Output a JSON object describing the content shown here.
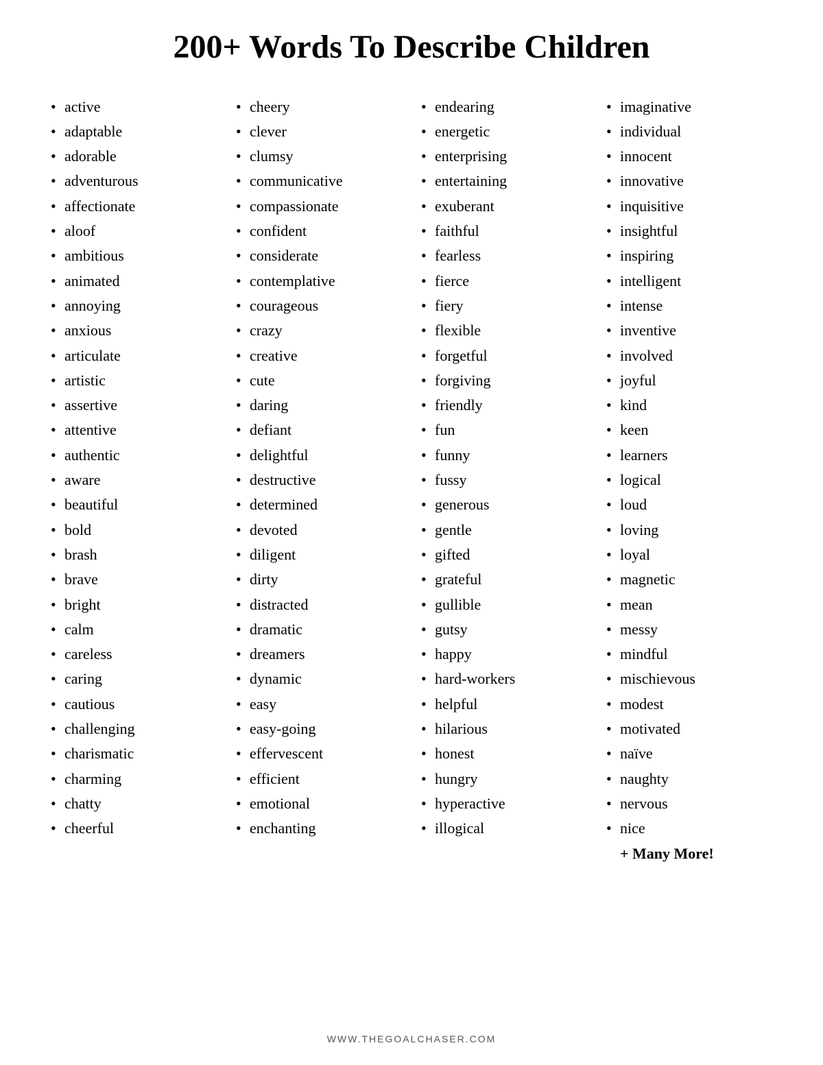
{
  "title": "200+ Words To Describe Children",
  "columns": [
    {
      "id": "col1",
      "items": [
        "active",
        "adaptable",
        "adorable",
        "adventurous",
        "affectionate",
        "aloof",
        "ambitious",
        "animated",
        "annoying",
        "anxious",
        "articulate",
        "artistic",
        "assertive",
        "attentive",
        "authentic",
        "aware",
        "beautiful",
        "bold",
        "brash",
        "brave",
        "bright",
        "calm",
        "careless",
        "caring",
        "cautious",
        "challenging",
        "charismatic",
        "charming",
        "chatty",
        "cheerful"
      ]
    },
    {
      "id": "col2",
      "items": [
        "cheery",
        "clever",
        "clumsy",
        "communicative",
        "compassionate",
        "confident",
        "considerate",
        "contemplative",
        "courageous",
        "crazy",
        "creative",
        "cute",
        "daring",
        "defiant",
        "delightful",
        "destructive",
        "determined",
        "devoted",
        "diligent",
        "dirty",
        "distracted",
        "dramatic",
        "dreamers",
        "dynamic",
        "easy",
        "easy-going",
        "effervescent",
        "efficient",
        "emotional",
        "enchanting"
      ]
    },
    {
      "id": "col3",
      "items": [
        "endearing",
        "energetic",
        "enterprising",
        "entertaining",
        "exuberant",
        "faithful",
        "fearless",
        "fierce",
        "fiery",
        "flexible",
        "forgetful",
        "forgiving",
        "friendly",
        "fun",
        "funny",
        "fussy",
        "generous",
        "gentle",
        "gifted",
        "grateful",
        "gullible",
        "gutsy",
        "happy",
        "hard-workers",
        "helpful",
        "hilarious",
        "honest",
        "hungry",
        "hyperactive",
        "illogical"
      ]
    },
    {
      "id": "col4",
      "items": [
        "imaginative",
        "individual",
        "innocent",
        "innovative",
        "inquisitive",
        "insightful",
        "inspiring",
        "intelligent",
        "intense",
        "inventive",
        "involved",
        "joyful",
        "kind",
        "keen",
        "learners",
        "logical",
        "loud",
        "loving",
        "loyal",
        "magnetic",
        "mean",
        "messy",
        "mindful",
        "mischievous",
        "modest",
        "motivated",
        "naïve",
        "naughty",
        "nervous",
        "nice"
      ]
    }
  ],
  "more_text": "+ Many More!",
  "footer": "WWW.THEGOALCHASER.COM"
}
